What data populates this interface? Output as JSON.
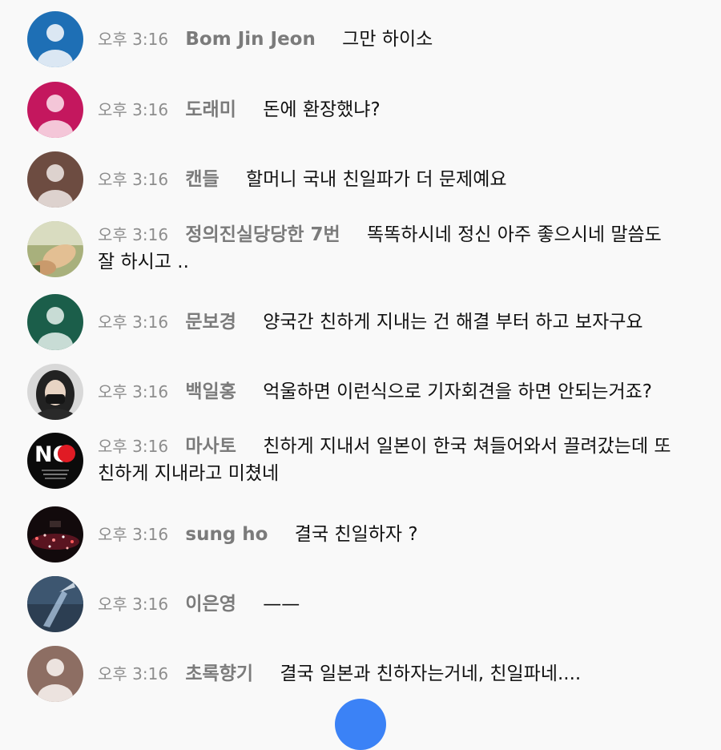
{
  "messages": [
    {
      "time": "오후 3:16",
      "author": "Bom Jin Jeon",
      "text": "그만 하이소",
      "avatar": {
        "kind": "default",
        "color": "#1e6fb5"
      }
    },
    {
      "time": "오후 3:16",
      "author": "도래미",
      "text": "돈에 환장했냐?",
      "avatar": {
        "kind": "default",
        "color": "#c4175e"
      }
    },
    {
      "time": "오후 3:16",
      "author": "캔들",
      "text": "할머니 국내 친일파가 더 문제예요",
      "avatar": {
        "kind": "default",
        "color": "#6d4c41"
      }
    },
    {
      "time": "오후 3:16",
      "author": "정의진실당당한 7번",
      "text": "똑똑하시네 정신 아주 좋으시네 말씀도 잘 하시고 ..",
      "avatar": {
        "kind": "photo-hand"
      }
    },
    {
      "time": "오후 3:16",
      "author": "문보경",
      "text": "양국간 친하게 지내는 건 해결 부터 하고 보자구요",
      "avatar": {
        "kind": "default",
        "color": "#1b5e4a"
      }
    },
    {
      "time": "오후 3:16",
      "author": "백일홍",
      "text": "억울하면 이런식으로 기자회견을 하면 안되는거죠?",
      "avatar": {
        "kind": "photo-person"
      }
    },
    {
      "time": "오후 3:16",
      "author": "마사토",
      "text": "친하게 지내서 일본이 한국 쳐들어와서 끌려갔는데 또 친하게 지내라고 미쳤네",
      "avatar": {
        "kind": "no-logo",
        "label": "NO"
      }
    },
    {
      "time": "오후 3:16",
      "author": "sung ho",
      "text": "결국 친일하자 ?",
      "avatar": {
        "kind": "photo-stage"
      }
    },
    {
      "time": "오후 3:16",
      "author": "이은영",
      "text": "——",
      "avatar": {
        "kind": "photo-sky"
      }
    },
    {
      "time": "오후 3:16",
      "author": "초록향기",
      "text": "결국 일본과 친하자는거네, 친일파네....",
      "avatar": {
        "kind": "default",
        "color": "#8d6e63"
      }
    }
  ]
}
